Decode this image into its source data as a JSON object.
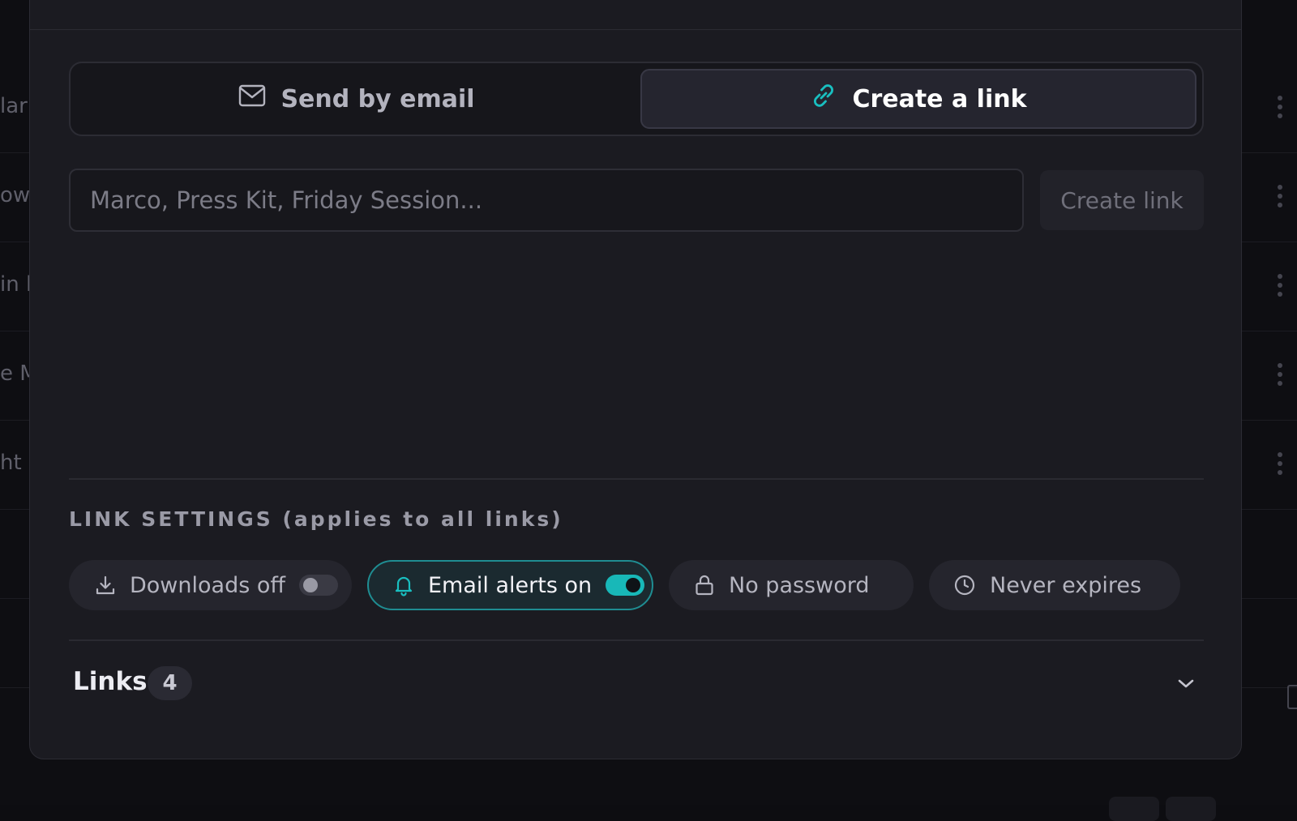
{
  "background": {
    "rows": [
      "lar",
      "ow",
      "in l",
      "e M",
      "ht ("
    ]
  },
  "tabs": {
    "email_label": "Send by email",
    "link_label": "Create a link",
    "active": "link"
  },
  "link_form": {
    "placeholder": "Marco, Press Kit, Friday Session...",
    "value": "",
    "submit_label": "Create link"
  },
  "settings": {
    "title": "LINK SETTINGS (applies to all links)",
    "downloads": {
      "label": "Downloads off",
      "enabled": false
    },
    "email_alerts": {
      "label": "Email alerts on",
      "enabled": true
    },
    "password": {
      "label": "No password"
    },
    "expiry": {
      "label": "Never expires"
    }
  },
  "links": {
    "label": "Links",
    "count": "4"
  },
  "colors": {
    "accent": "#18b8b8",
    "modal_bg": "#1b1b21",
    "page_bg": "#0e0e12"
  },
  "icons": [
    "mail-icon",
    "link-icon",
    "download-icon",
    "bell-icon",
    "lock-icon",
    "clock-icon",
    "chevron-down-icon",
    "more-vertical-icon"
  ]
}
